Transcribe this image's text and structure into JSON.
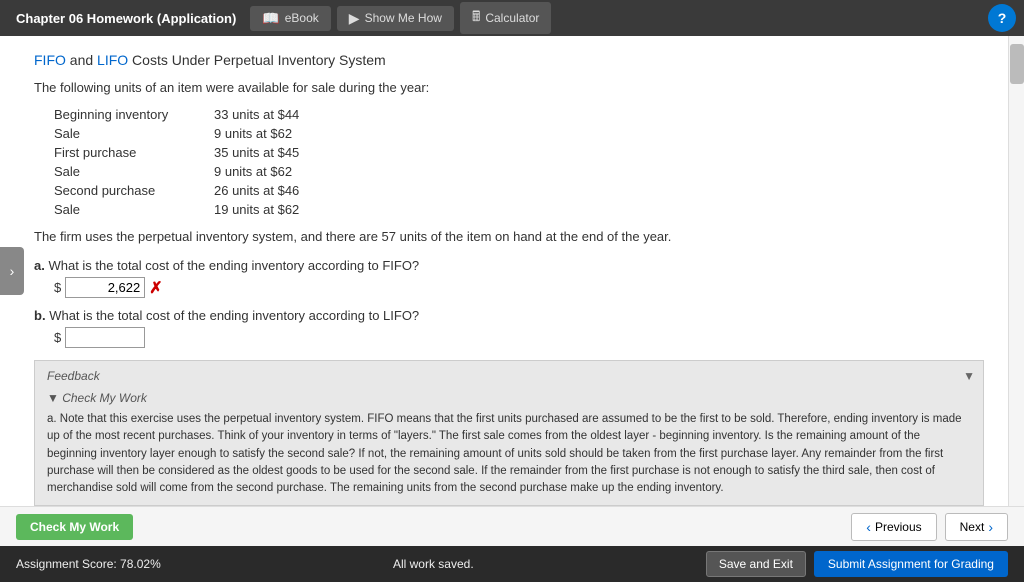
{
  "header": {
    "title": "Chapter 06 Homework (Application)",
    "tabs": [
      {
        "label": "eBook",
        "icon": "📖"
      },
      {
        "label": "Show Me How",
        "icon": "▶"
      },
      {
        "label": "Calculator",
        "icon": "🖩"
      }
    ],
    "help_icon": "?"
  },
  "content": {
    "question_title": "FIFO and LIFO Costs Under Perpetual Inventory System",
    "intro": "The following units of an item were available for sale during the year:",
    "inventory_items": [
      {
        "label": "Beginning inventory",
        "value": "33 units at $44"
      },
      {
        "label": "Sale",
        "value": "9 units at $62"
      },
      {
        "label": "First purchase",
        "value": "35 units at $45"
      },
      {
        "label": "Sale",
        "value": "9 units at $62"
      },
      {
        "label": "Second purchase",
        "value": "26 units at $46"
      },
      {
        "label": "Sale",
        "value": "19 units at $62"
      }
    ],
    "firm_text": "The firm uses the perpetual inventory system, and there are 57 units of the item on hand at the end of the year.",
    "part_a": {
      "label": "a.",
      "question": "What is the total cost of the ending inventory according to FIFO?",
      "answer_value": "2,622",
      "status": "wrong"
    },
    "part_b": {
      "label": "b.",
      "question": "What is the total cost of the ending inventory according to LIFO?",
      "answer_value": ""
    },
    "feedback": {
      "header": "Feedback",
      "check_my_work_label": "▼ Check My Work",
      "text": "a. Note that this exercise uses the perpetual inventory system. FIFO means that the first units purchased are assumed to be the first to be sold. Therefore, ending inventory is made up of the most recent purchases. Think of your inventory in terms of \"layers.\" The first sale comes from the oldest layer - beginning inventory. Is the remaining amount of the beginning inventory layer enough to satisfy the second sale? If not, the remaining amount of units sold should be taken from the first purchase layer. Any remainder from the first purchase will then be considered as the oldest goods to be used for the second sale. If the remainder from the first purchase is not enough to satisfy the third sale, then cost of merchandise sold will come from the second purchase. The remaining units from the second purchase make up the ending inventory."
    }
  },
  "bottom_nav": {
    "check_my_work_label": "Check My Work",
    "previous_label": "Previous",
    "next_label": "Next"
  },
  "status_bar": {
    "score_label": "Assignment Score: 78.02%",
    "saved_label": "All work saved.",
    "save_exit_label": "Save and Exit",
    "submit_label": "Submit Assignment for Grading"
  }
}
